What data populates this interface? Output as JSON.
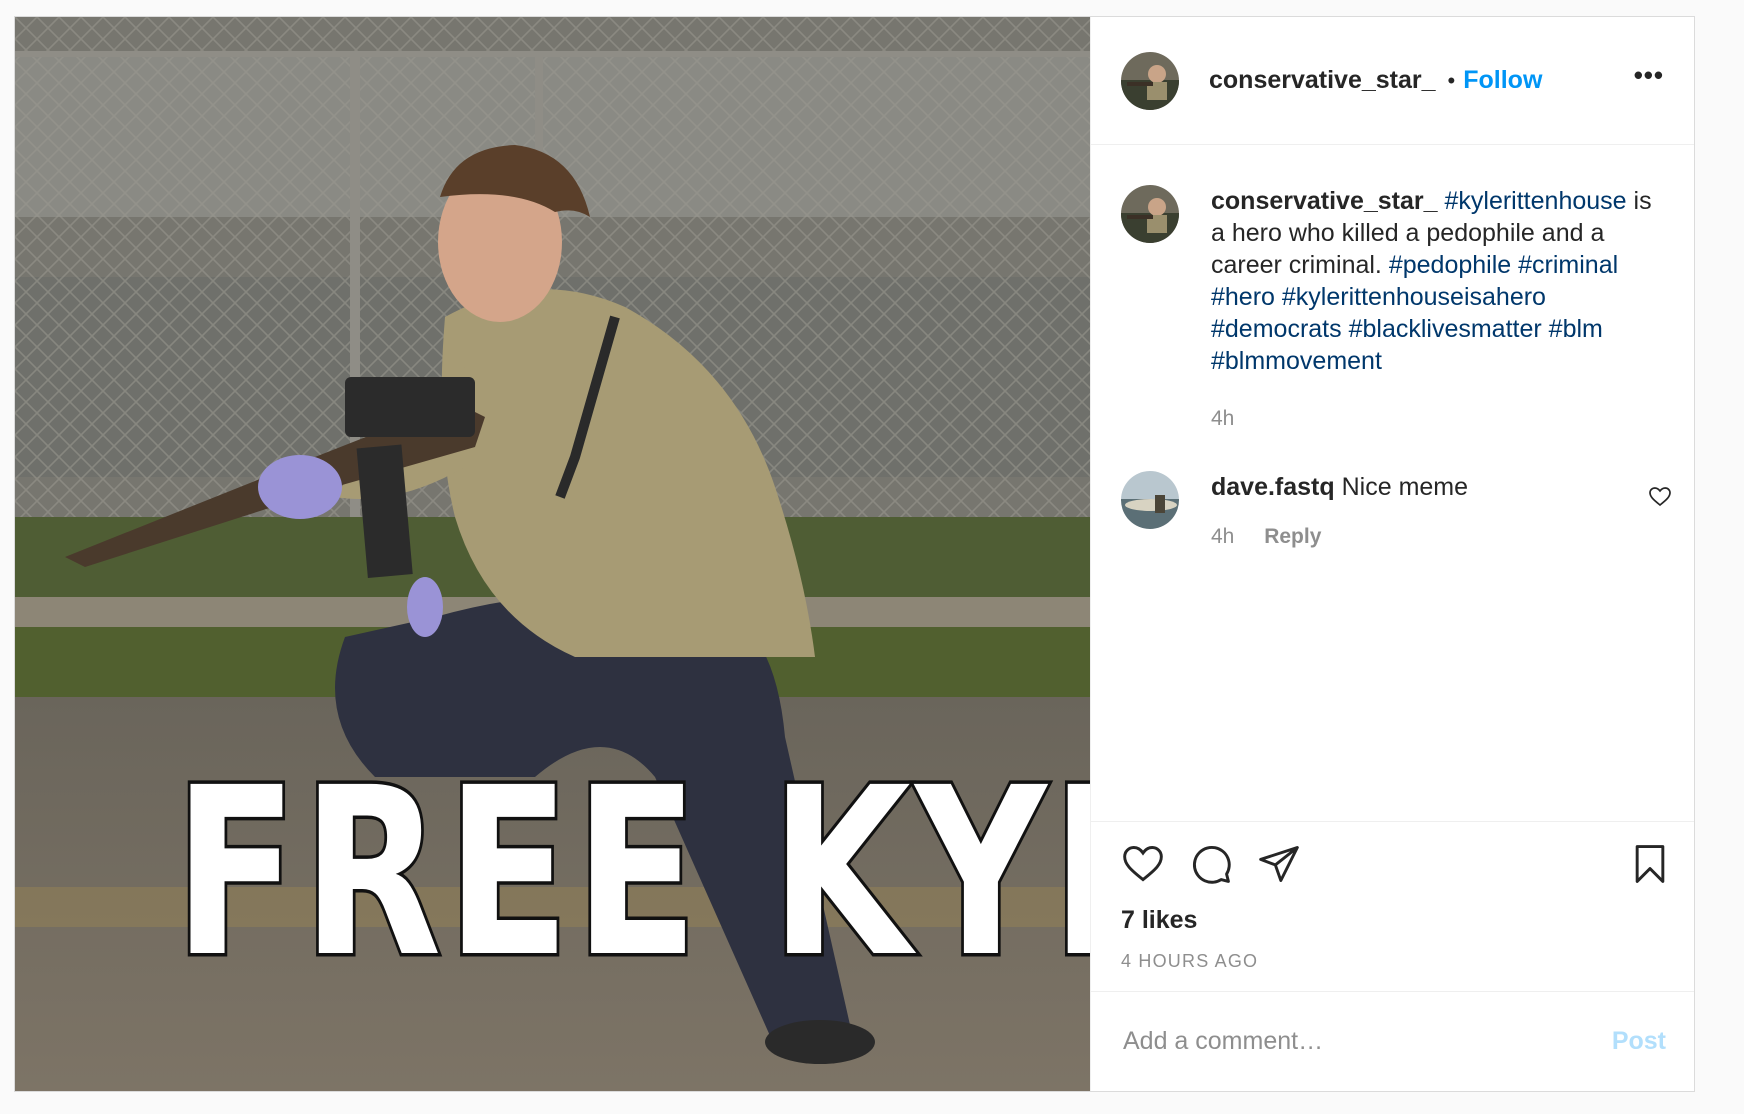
{
  "media": {
    "overlay_text": "FREE KYLE",
    "photo": "Photo of a young man in a tan t-shirt, crouching on pavement and holding a rifle in front of a chain-link fence at night"
  },
  "header": {
    "username": "conservative_star_",
    "separator": "•",
    "follow_label": "Follow",
    "more_label": "•••"
  },
  "caption": {
    "username": "conservative_star_",
    "text_1": " is a hero who killed a pedophile and a career criminal. ",
    "tags_lead": "#kylerittenhouse",
    "tags": [
      "#pedophile",
      "#criminal",
      "#hero",
      "#kylerittenhouseisahero",
      "#democrats",
      "#blacklivesmatter",
      "#blm",
      "#blmmovement"
    ],
    "time": "4h"
  },
  "comments": [
    {
      "username": "dave.fastq",
      "text": "Nice meme",
      "time": "4h",
      "reply_label": "Reply"
    }
  ],
  "actions": {
    "likes": "7 likes",
    "timestamp": "4 HOURS AGO"
  },
  "add_comment": {
    "placeholder": "Add a comment…",
    "post_label": "Post"
  },
  "colors": {
    "accent": "#0095f6",
    "hashtag": "#00376b",
    "muted": "#8e8e8e",
    "post_disabled": "#b2dffc"
  }
}
